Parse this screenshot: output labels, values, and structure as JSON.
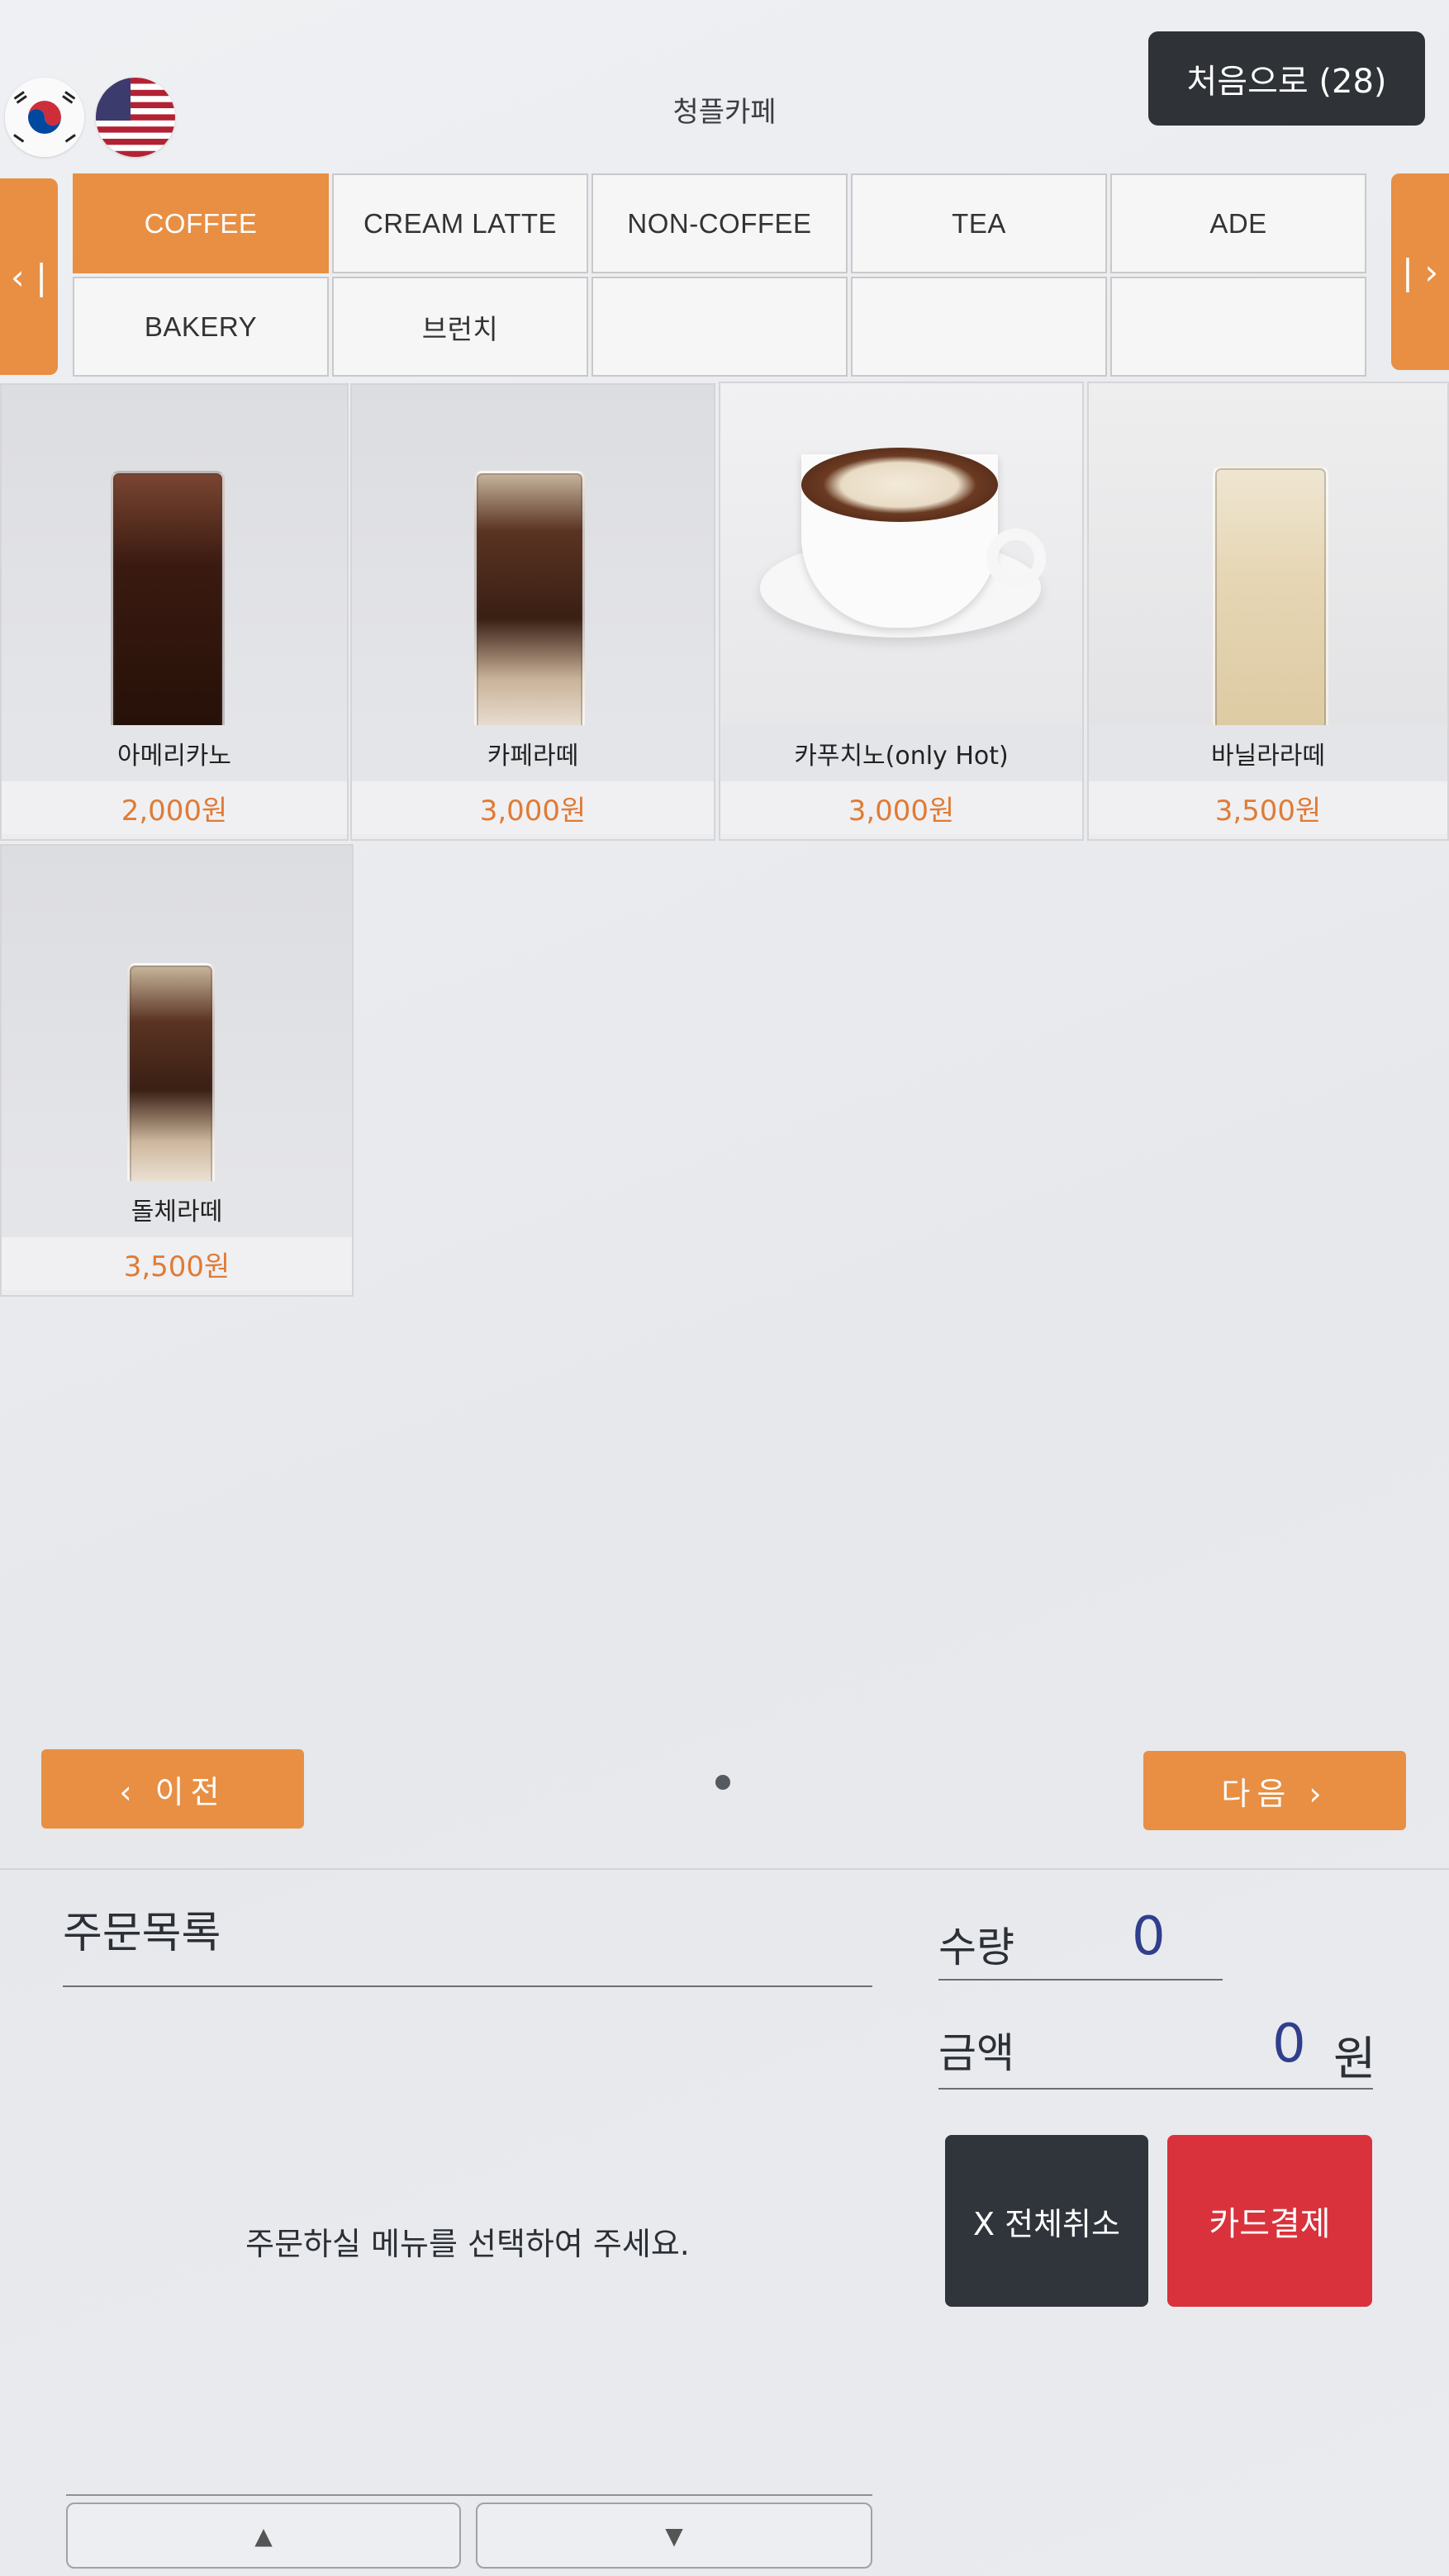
{
  "header": {
    "languages": [
      {
        "name": "korean",
        "icon": "korea-flag-icon"
      },
      {
        "name": "english",
        "icon": "usa-flag-icon"
      }
    ],
    "store_name": "청플카페",
    "home_button": "처음으로 (28)"
  },
  "categories": {
    "prev_arrow": "‹ |",
    "next_arrow": "| ›",
    "items": [
      "COFFEE",
      "CREAM LATTE",
      "NON-COFFEE",
      "TEA",
      "ADE",
      "BAKERY",
      "브런치",
      "",
      "",
      ""
    ],
    "active": "COFFEE"
  },
  "menu": {
    "items": [
      {
        "name": "아메리카노",
        "price": "2,000원"
      },
      {
        "name": "카페라떼",
        "price": "3,000원"
      },
      {
        "name": "카푸치노(only Hot)",
        "price": "3,000원"
      },
      {
        "name": "바닐라라떼",
        "price": "3,500원"
      },
      {
        "name": "돌체라떼",
        "price": "3,500원"
      }
    ]
  },
  "pager": {
    "prev": "‹ 이전",
    "next": "다음 ›"
  },
  "order": {
    "title": "주문목록",
    "empty_message": "주문하실 메뉴를 선택하여 주세요.",
    "qty_label": "수량",
    "qty_value": "0",
    "amount_label": "금액",
    "amount_value": "0",
    "currency": "원",
    "cancel_all": "X 전체취소",
    "card_pay": "카드결제",
    "scroll_up": "▲",
    "scroll_down": "▼"
  },
  "colors": {
    "accent": "#e88f43",
    "price": "#e07b35",
    "dark_button": "#30353b",
    "pay_button": "#d9323c",
    "number": "#2f3f8c"
  }
}
